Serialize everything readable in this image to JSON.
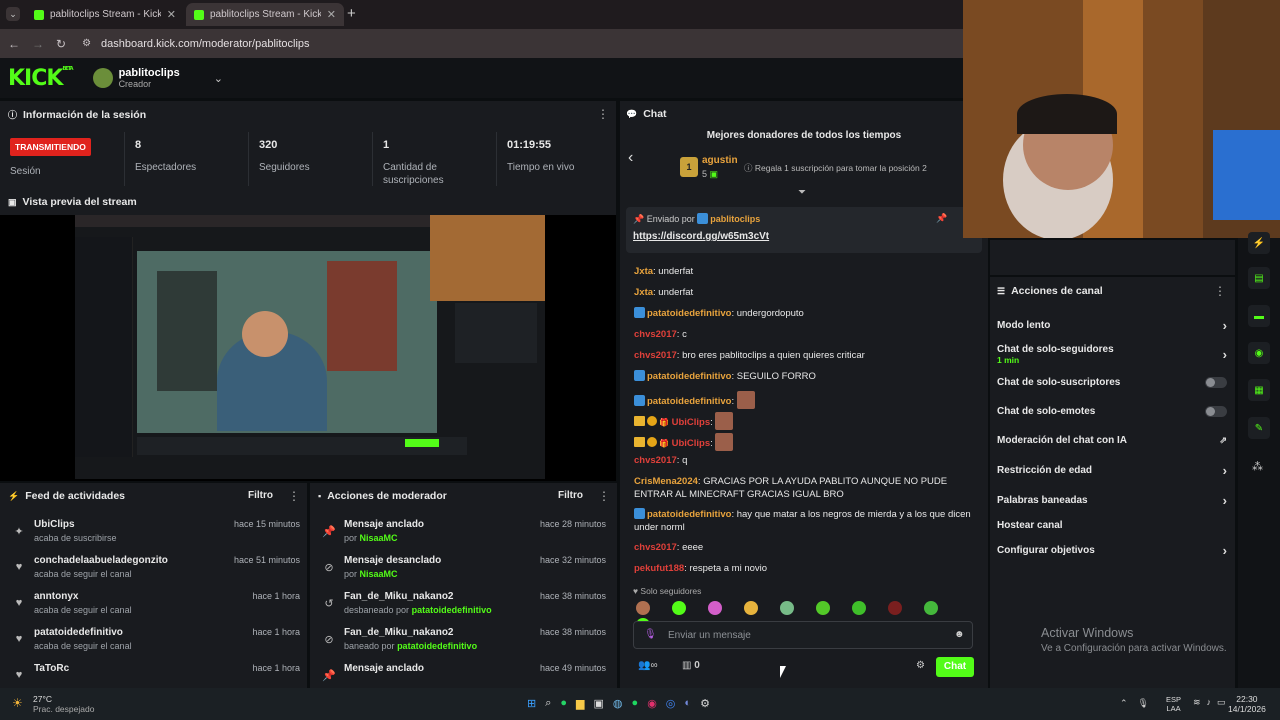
{
  "browser": {
    "tabs": [
      {
        "title": "pablitoclips Stream - Kick Dashb"
      },
      {
        "title": "pablitoclips Stream - Kick Dashb"
      }
    ],
    "url": "dashboard.kick.com/moderator/pablitoclips",
    "new_tab": "+"
  },
  "header": {
    "logo": "KICK",
    "beta": "BETA",
    "channel": "pablitoclips",
    "role": "Creador"
  },
  "session": {
    "title": "Información de la sesión",
    "status": "TRANSMITIENDO",
    "status_label": "Sesión",
    "stats": [
      {
        "value": "8",
        "label": "Espectadores"
      },
      {
        "value": "320",
        "label": "Seguidores"
      },
      {
        "value": "1",
        "label": "Cantidad de suscripciones"
      },
      {
        "value": "01:19:55",
        "label": "Tiempo en vivo"
      }
    ]
  },
  "preview": {
    "title": "Vista previa del stream"
  },
  "activity": {
    "title": "Feed de actividades",
    "filter": "Filtro",
    "items": [
      {
        "name": "UbiClips",
        "desc": "acaba de suscribirse",
        "time": "hace 15 minutos",
        "icon": "sparkle-icon"
      },
      {
        "name": "conchadelaabueladegonzito",
        "desc": "acaba de seguir el canal",
        "time": "hace 51 minutos",
        "icon": "heart-icon"
      },
      {
        "name": "anntonyx",
        "desc": "acaba de seguir el canal",
        "time": "hace 1 hora",
        "icon": "heart-icon"
      },
      {
        "name": "patatoidedefinitivo",
        "desc": "acaba de seguir el canal",
        "time": "hace 1 hora",
        "icon": "heart-icon"
      },
      {
        "name": "TaToRc",
        "desc": "",
        "time": "hace 1 hora",
        "icon": "heart-icon"
      }
    ]
  },
  "modactions": {
    "title": "Acciones de moderador",
    "filter": "Filtro",
    "items": [
      {
        "action": "Mensaje anclado",
        "prefix": "por",
        "user": "NisaaMC",
        "time": "hace 28 minutos",
        "icon": "pin-icon"
      },
      {
        "action": "Mensaje desanclado",
        "prefix": "por",
        "user": "NisaaMC",
        "time": "hace 32 minutos",
        "icon": "unpin-icon"
      },
      {
        "action": "Fan_de_Miku_nakano2",
        "prefix": "desbaneado por",
        "user": "patatoidedefinitivo",
        "time": "hace 38 minutos",
        "icon": "undo-icon"
      },
      {
        "action": "Fan_de_Miku_nakano2",
        "prefix": "baneado por",
        "user": "patatoidedefinitivo",
        "time": "hace 38 minutos",
        "icon": "ban-icon"
      },
      {
        "action": "Mensaje anclado",
        "prefix": "",
        "user": "",
        "time": "hace 49 minutos",
        "icon": "pin-icon"
      }
    ]
  },
  "chat": {
    "title": "Chat",
    "leaderboard_title": "Mejores donadores de todos los tiempos",
    "top_rank": "1",
    "top_user": "agustin",
    "top_count": "5",
    "top_hint": "Regala 1 suscripción para tomar la posición 2",
    "pinned_label": "Enviado por",
    "pinned_user": "pablitoclips",
    "pinned_link": "https://discord.gg/w65m3cVt",
    "messages": [
      {
        "user": "Jxta",
        "color": "#e8a33d",
        "text": "underfat",
        "badges": ""
      },
      {
        "user": "Jxta",
        "color": "#e8a33d",
        "text": "underfat",
        "badges": ""
      },
      {
        "user": "patatoidedefinitivo",
        "color": "#e8a33d",
        "text": "undergordoputo",
        "badges": "v"
      },
      {
        "user": "chvs2017",
        "color": "#e0403a",
        "text": "c",
        "badges": ""
      },
      {
        "user": "chvs2017",
        "color": "#e0403a",
        "text": "bro eres pablitoclips a quien quieres criticar",
        "badges": ""
      },
      {
        "user": "patatoidedefinitivo",
        "color": "#e8a33d",
        "text": "SEGUILO FORRO",
        "badges": "v"
      },
      {
        "user": "patatoidedefinitivo",
        "color": "#e8a33d",
        "text": "",
        "badges": "v",
        "emote": true
      },
      {
        "user": "UbiClips",
        "color": "#e0403a",
        "text": "",
        "badges": "cs",
        "emote": true
      },
      {
        "user": "UbiClips",
        "color": "#e0403a",
        "text": "",
        "badges": "cs",
        "emote": true
      },
      {
        "user": "chvs2017",
        "color": "#e0403a",
        "text": "q",
        "badges": ""
      },
      {
        "user": "CrisMena2024",
        "color": "#e8a33d",
        "text": "GRACIAS POR LA AYUDA PABLITO AUNQUE NO PUDE ENTRAR AL MINECRAFT GRACIAS IGUAL BRO",
        "badges": ""
      },
      {
        "user": "patatoidedefinitivo",
        "color": "#e8a33d",
        "text": "hay que matar a los negros de mierda y a los que dicen under norml",
        "badges": "v"
      },
      {
        "user": "chvs2017",
        "color": "#e0403a",
        "text": "eeee",
        "badges": ""
      },
      {
        "user": "pekufut188",
        "color": "#e0403a",
        "text": "respeta a mi novio",
        "badges": ""
      }
    ],
    "mode_label": "Solo seguidores",
    "input_placeholder": "Enviar un mensaje",
    "points": "0",
    "send": "Chat"
  },
  "channel_actions": {
    "title": "Acciones de canal",
    "items": [
      {
        "label": "Modo lento",
        "sub": "",
        "control": "chevron"
      },
      {
        "label": "Chat de solo-seguidores",
        "sub": "1 min",
        "control": "chevron"
      },
      {
        "label": "Chat de solo-suscriptores",
        "sub": "",
        "control": "toggle"
      },
      {
        "label": "Chat de solo-emotes",
        "sub": "",
        "control": "toggle"
      },
      {
        "label": "Moderación del chat con IA",
        "sub": "",
        "control": "external"
      },
      {
        "label": "Restricción de edad",
        "sub": "",
        "control": "chevron"
      },
      {
        "label": "Palabras baneadas",
        "sub": "",
        "control": "chevron"
      },
      {
        "label": "Hostear canal",
        "sub": "",
        "control": "none"
      },
      {
        "label": "Configurar objetivos",
        "sub": "",
        "control": "chevron"
      }
    ]
  },
  "watermark": {
    "title": "Activar Windows",
    "sub": "Ve a Configuración para activar Windows."
  },
  "taskbar": {
    "temp": "27°C",
    "weather": "Prac. despejado",
    "lang1": "ESP",
    "lang2": "LAA",
    "time": "22:30",
    "date": "14/1/2026"
  },
  "colors": {
    "accent": "#53fc18",
    "live": "#e0231d"
  }
}
